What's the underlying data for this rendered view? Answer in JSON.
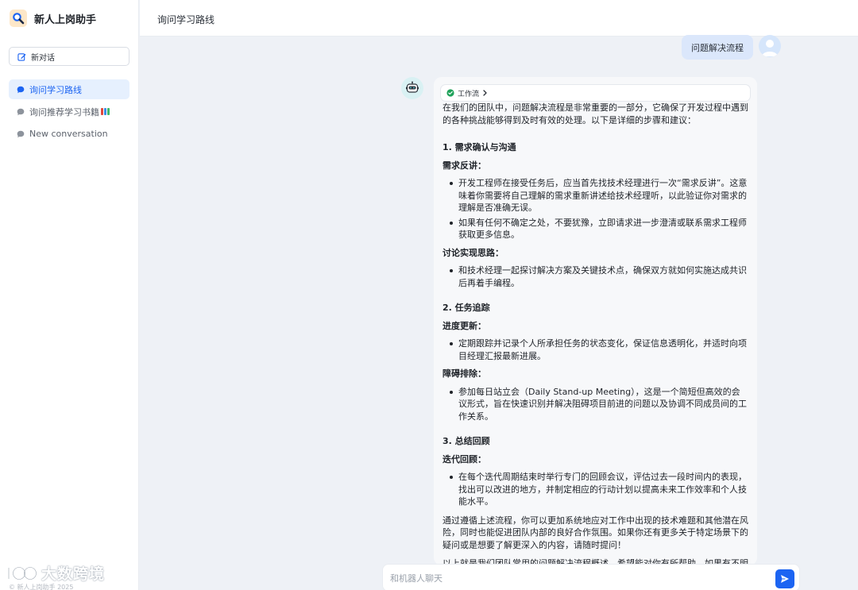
{
  "app": {
    "name": "新人上岗助手",
    "copyright": "© 新人上岗助手 2025",
    "watermark": "大数跨境"
  },
  "sidebar": {
    "new_chat_label": "新对话",
    "conversations": [
      {
        "label": "询问学习路线",
        "active": true
      },
      {
        "label": "询问推荐学习书籍"
      },
      {
        "label": "New conversation"
      }
    ]
  },
  "header": {
    "title": "询问学习路线"
  },
  "chat": {
    "user_message": "问题解决流程",
    "workflow_label": "工作流",
    "bot": {
      "intro": "在我们的团队中，问题解决流程是非常重要的一部分，它确保了开发过程中遇到的各种挑战能够得到及时有效的处理。以下是详细的步骤和建议：",
      "s1": {
        "title": "1. 需求确认与沟通",
        "l1": "需求反讲：",
        "b1": "开发工程师在接受任务后，应当首先找技术经理进行一次“需求反讲”。这意味着你需要将自己理解的需求重新讲述给技术经理听，以此验证你对需求的理解是否准确无误。",
        "b2": "如果有任何不确定之处，不要犹豫，立即请求进一步澄清或联系需求工程师获取更多信息。",
        "l2": "讨论实现思路：",
        "b3": "和技术经理一起探讨解决方案及关键技术点，确保双方就如何实施达成共识后再着手编程。"
      },
      "s2": {
        "title": "2. 任务追踪",
        "l1": "进度更新：",
        "b1": "定期跟踪并记录个人所承担任务的状态变化，保证信息透明化，并适时向项目经理汇报最新进展。",
        "l2": "障碍排除：",
        "b2": "参加每日站立会（Daily Stand-up Meeting），这是一个简短但高效的会议形式，旨在快速识别并解决阻碍项目前进的问题以及协调不同成员间的工作关系。"
      },
      "s3": {
        "title": "3. 总结回顾",
        "l1": "迭代回顾：",
        "b1": "在每个迭代周期结束时举行专门的回顾会议，评估过去一段时间内的表现，找出可以改进的地方，并制定相应的行动计划以提高未来工作效率和个人技能水平。"
      },
      "p1": "通过遵循上述流程，你可以更加系统地应对工作中出现的技术难题和其他潜在风险，同时也能促进团队内部的良好合作氛围。如果你还有更多关于特定场景下的疑问或是想要了解更深入的内容，请随时提问！",
      "p2": "以上就是我们团队常用的问题解决流程概述，希望能对你有所帮助。如果有不明白的地方欢迎继续咨询。"
    }
  },
  "input": {
    "placeholder": "和机器人聊天"
  },
  "colors": {
    "accent": "#1c64f2",
    "active_bg": "#e6f0fe",
    "user_bubble": "#dbe7fb",
    "success": "#1fa25a"
  }
}
